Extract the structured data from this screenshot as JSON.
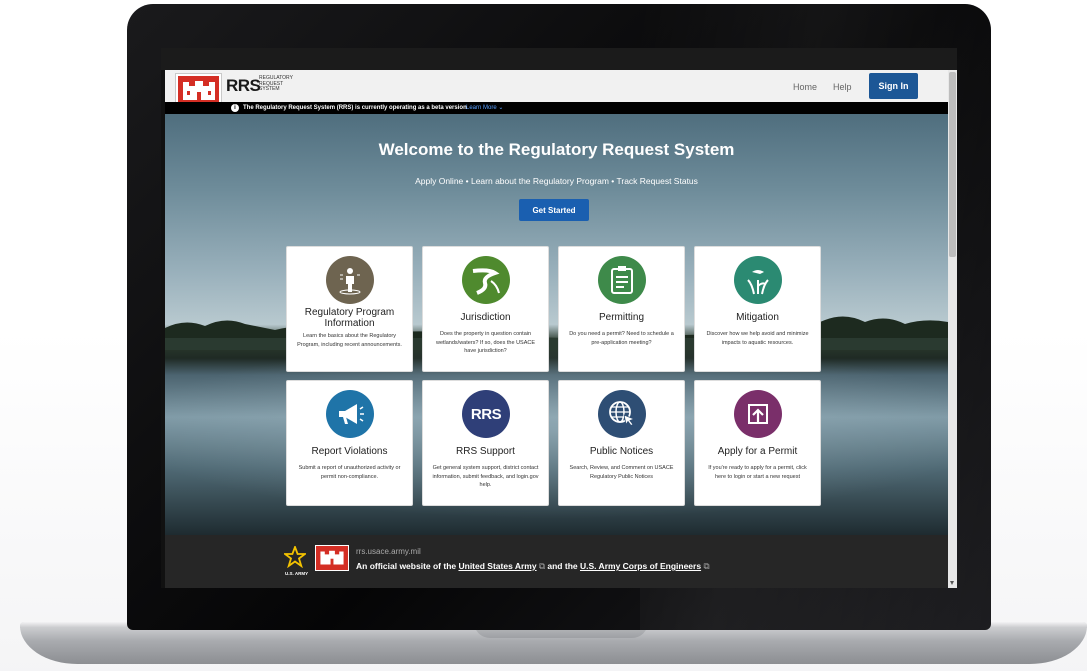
{
  "brand": {
    "logo_text": "RRS",
    "logo_subtitle": [
      "REGULATORY",
      "REQUEST",
      "SYSTEM"
    ]
  },
  "nav": {
    "home": "Home",
    "help": "Help",
    "sign_in": "Sign In"
  },
  "beta_banner": {
    "info_glyph": "i",
    "text": "The Regulatory Request System (RRS) is currently operating as a beta version",
    "learn_more": "Learn More ⌄"
  },
  "hero": {
    "title": "Welcome to the Regulatory Request System",
    "subtitle": "Apply Online • Learn about the Regulatory Program • Track Request Status",
    "cta": "Get Started"
  },
  "cards": [
    {
      "title": "Regulatory Program Information",
      "desc": "Learn the basics about the Regulatory Program, including recent announcements.",
      "icon": "person-info-icon",
      "color": "#6e6450"
    },
    {
      "title": "Jurisdiction",
      "desc": "Does the property in question contain wetlands/waters? If so, does the USACE have jurisdiction?",
      "icon": "river-icon",
      "color": "#4f8a2e"
    },
    {
      "title": "Permitting",
      "desc": "Do you need a permit? Need to schedule a pre-application meeting?",
      "icon": "clipboard-icon",
      "color": "#3e8a4a"
    },
    {
      "title": "Mitigation",
      "desc": "Discover how we help avoid and minimize impacts to aquatic resources.",
      "icon": "wetland-bird-icon",
      "color": "#2b8a72"
    },
    {
      "title": "Report Violations",
      "desc": "Submit a report of unauthorized activity or permit non-compliance.",
      "icon": "megaphone-icon",
      "color": "#1f74a8"
    },
    {
      "title": "RRS Support",
      "desc": "Get general system support, district contact information, submit feedback, and login.gov help.",
      "icon": "rrs-icon",
      "icon_text": "RRS",
      "color": "#2f3f78"
    },
    {
      "title": "Public Notices",
      "desc": "Search, Review, and Comment on USACE Regulatory Public Notices",
      "icon": "globe-cursor-icon",
      "color": "#2e4e74"
    },
    {
      "title": "Apply for a Permit",
      "desc": "If you're ready to apply for a permit, click here to login or start a new request",
      "icon": "upload-icon",
      "color": "#7a2f6a"
    }
  ],
  "footer": {
    "army_label": "U.S. ARMY",
    "url": "rrs.usace.army.mil",
    "official_prefix": "An official website of the ",
    "army_link": "United States Army",
    "and": " and the ",
    "corps_link": "U.S. Army Corps of Engineers",
    "ext": "⧉"
  },
  "colors": {
    "brand_red": "#d42e24",
    "primary_blue": "#1c5796",
    "cta_blue": "#1a5fb0",
    "footer_bg": "#262626"
  }
}
